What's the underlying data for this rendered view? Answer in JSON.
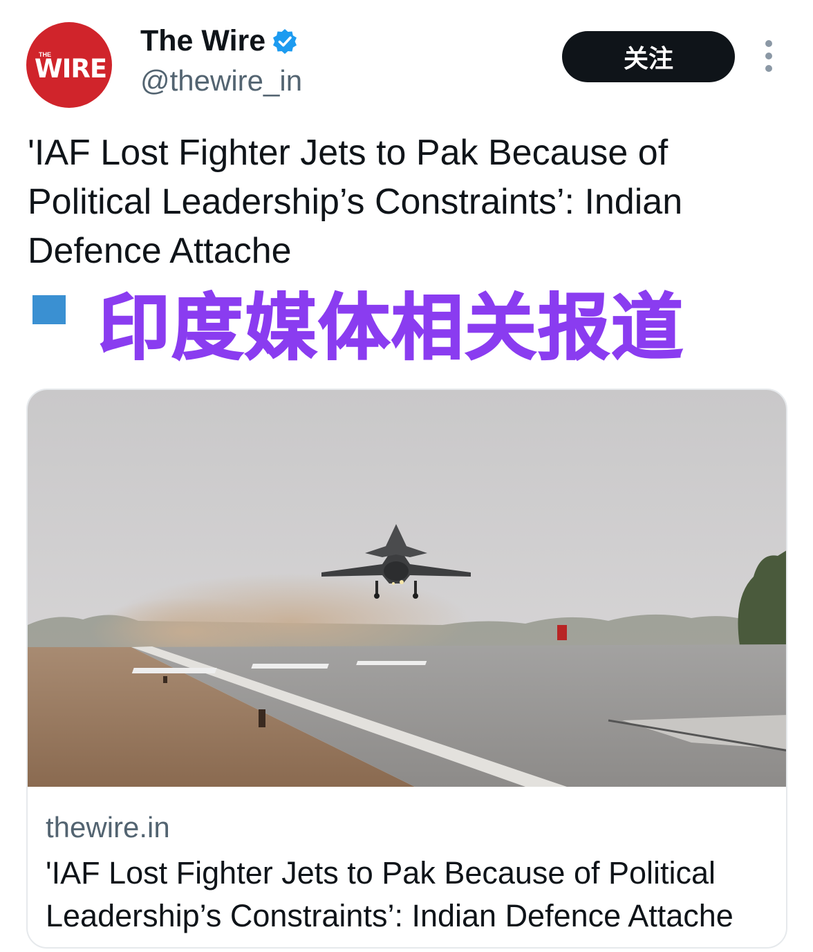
{
  "account": {
    "avatar_label": "WIRE",
    "avatar_small_label": "THE",
    "display_name": "The Wire",
    "handle": "@thewire_in",
    "verified_icon": "verified-badge-icon",
    "brand_color": "#d0242b",
    "verified_color": "#1d9bf0"
  },
  "actions": {
    "follow_label": "关注",
    "more_icon": "more-vertical-icon"
  },
  "tweet": {
    "text": "'IAF Lost Fighter Jets to Pak Because of Political Leadership’s Constraints’: Indian Defence Attache"
  },
  "annotation": {
    "text": "印度媒体相关报道",
    "color": "#8a3cf0",
    "marker_color": "#3a90d2"
  },
  "card": {
    "image_description_icon": "fighter-jet-runway-photo",
    "domain": "thewire.in",
    "title": "'IAF Lost Fighter Jets to Pak Because of Political Leadership’s Constraints’: Indian Defence Attache"
  }
}
